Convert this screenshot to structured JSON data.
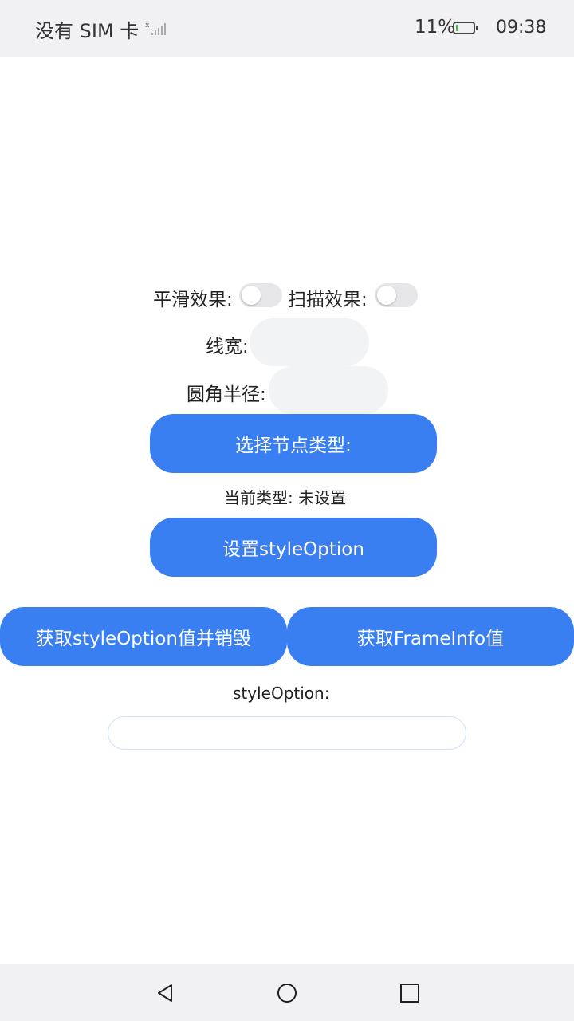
{
  "status_bar": {
    "carrier": "没有 SIM 卡",
    "signal_icon": "signal-icon",
    "battery_percent": "11%",
    "battery_icon": "battery-icon",
    "time": "09:38"
  },
  "controls": {
    "smooth_label": "平滑效果:",
    "smooth_on": false,
    "scan_label": "扫描效果:",
    "scan_on": false,
    "line_width_label": "线宽:",
    "line_width_value": "",
    "corner_radius_label": "圆角半径:",
    "corner_radius_value": "",
    "select_node_type_button": "选择节点类型:",
    "current_type_text": "当前类型: 未设置",
    "set_style_option_button": "设置styleOption",
    "get_style_option_destroy_button": "获取styleOption值并销毁",
    "get_frame_info_button": "获取FrameInfo值",
    "style_option_label": "styleOption:",
    "style_option_output": ""
  },
  "nav_bar": {
    "back_icon": "back-triangle-icon",
    "home_icon": "home-circle-icon",
    "recents_icon": "recents-square-icon"
  },
  "colors": {
    "accent": "#3a7ff1",
    "toggle_off": "#e6e6e8",
    "input_bg": "#f1f3f5",
    "bar_bg": "#f1f1f3"
  }
}
